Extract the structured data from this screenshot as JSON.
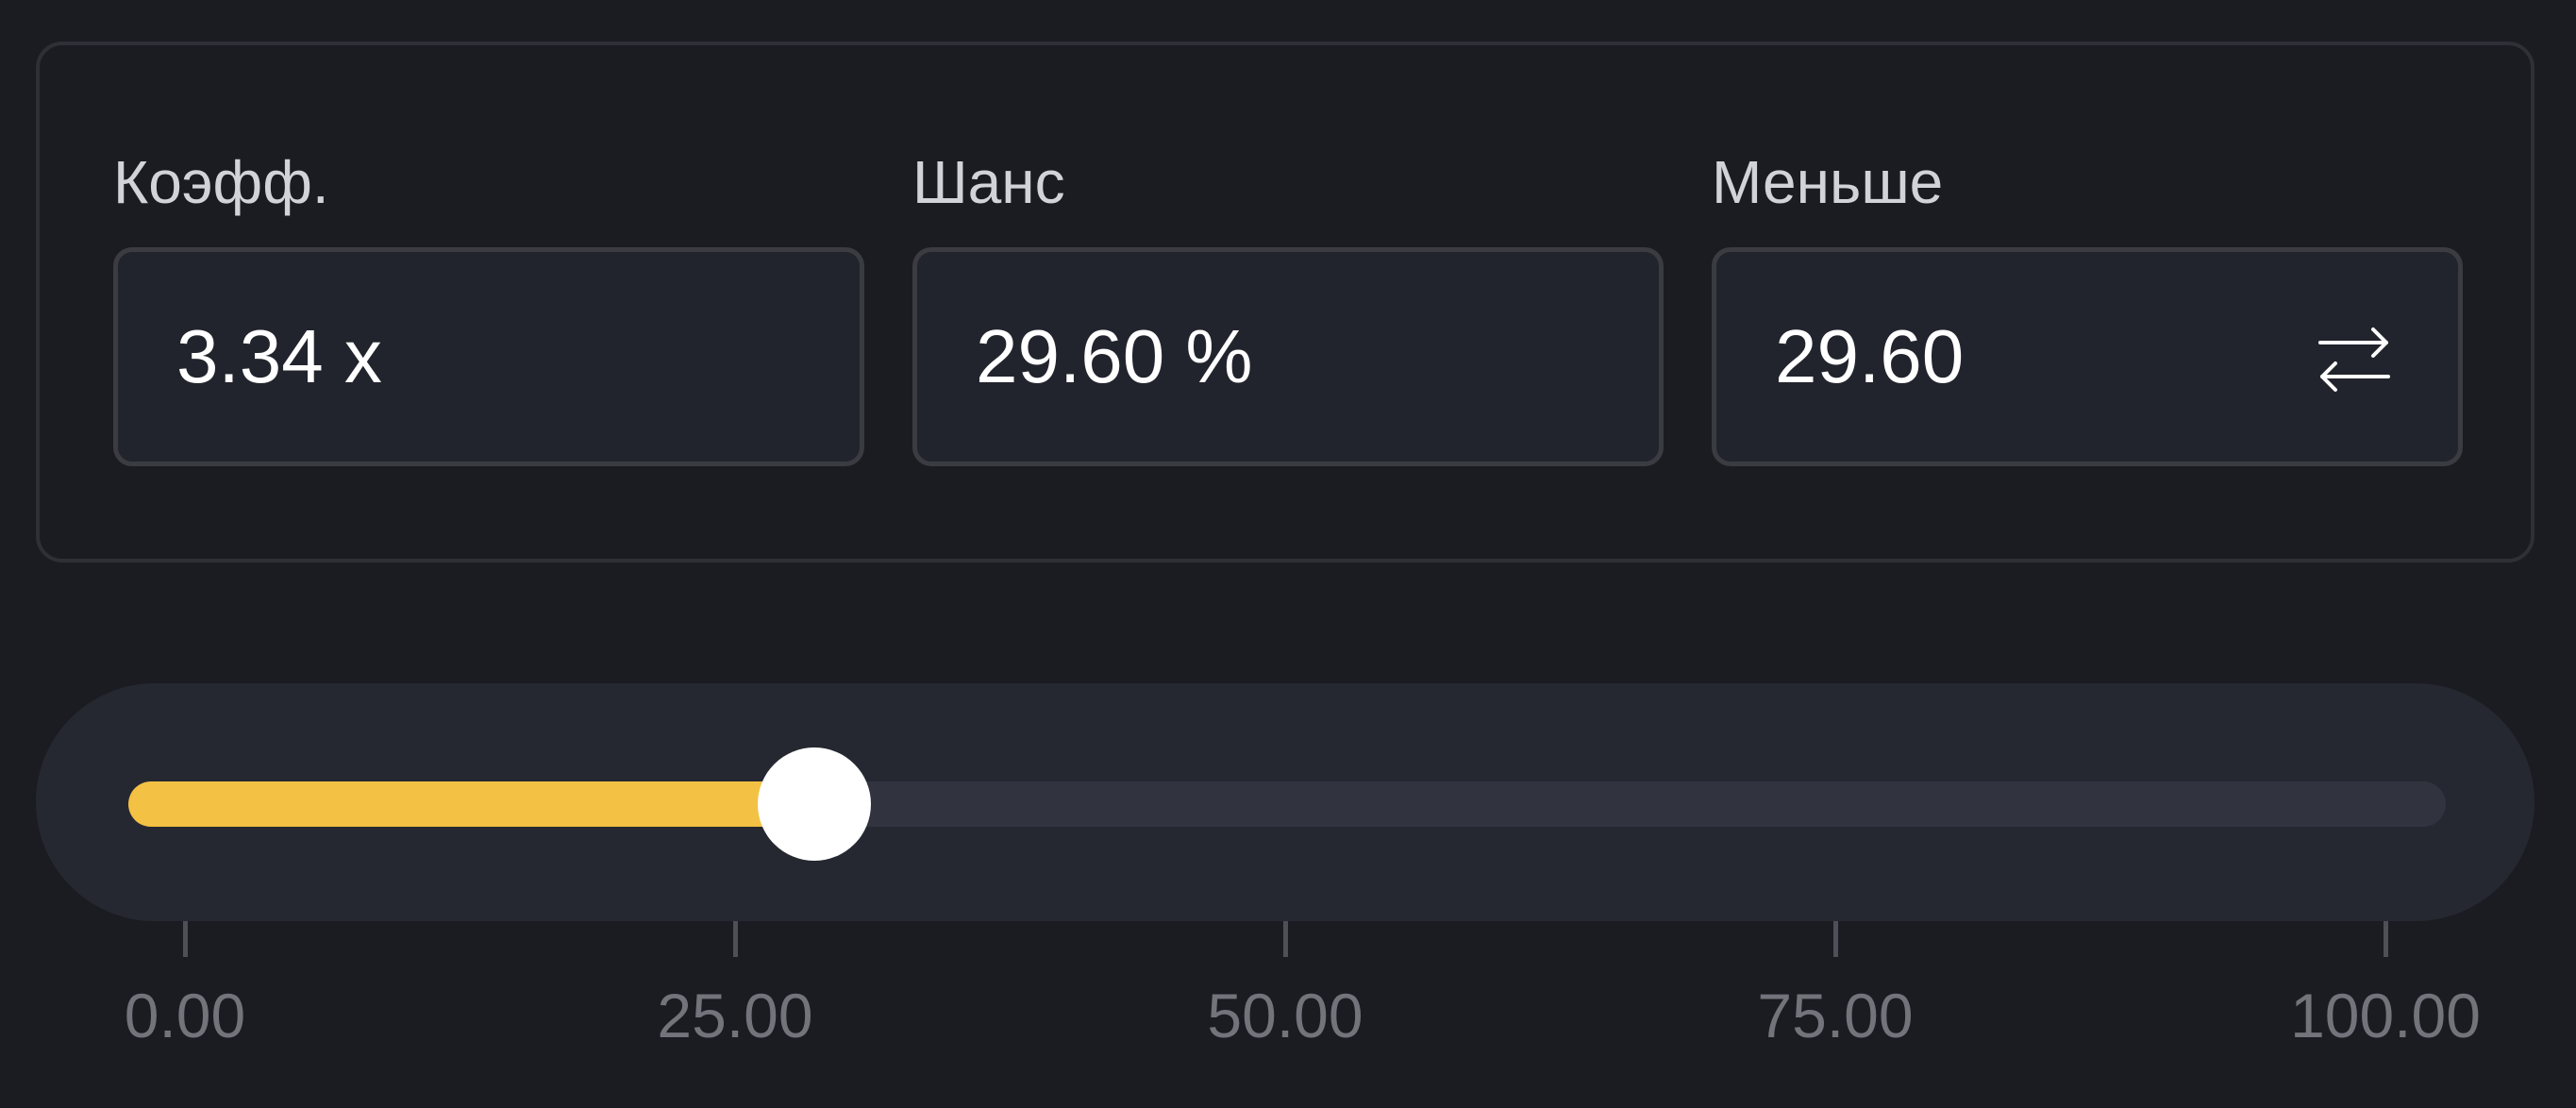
{
  "fields": {
    "multiplier": {
      "label": "Коэфф.",
      "value": "3.34 x"
    },
    "chance": {
      "label": "Шанс",
      "value": "29.60 %"
    },
    "target": {
      "label": "Меньше",
      "value": "29.60",
      "swap_icon": "swap-arrows-icon"
    }
  },
  "slider": {
    "value": 29.6,
    "min": 0,
    "max": 100,
    "fill_color": "#f3c143",
    "track_color": "#31333f",
    "thumb_color": "#ffffff"
  },
  "scale": {
    "ticks": [
      "0.00",
      "25.00",
      "50.00",
      "75.00",
      "100.00"
    ]
  }
}
